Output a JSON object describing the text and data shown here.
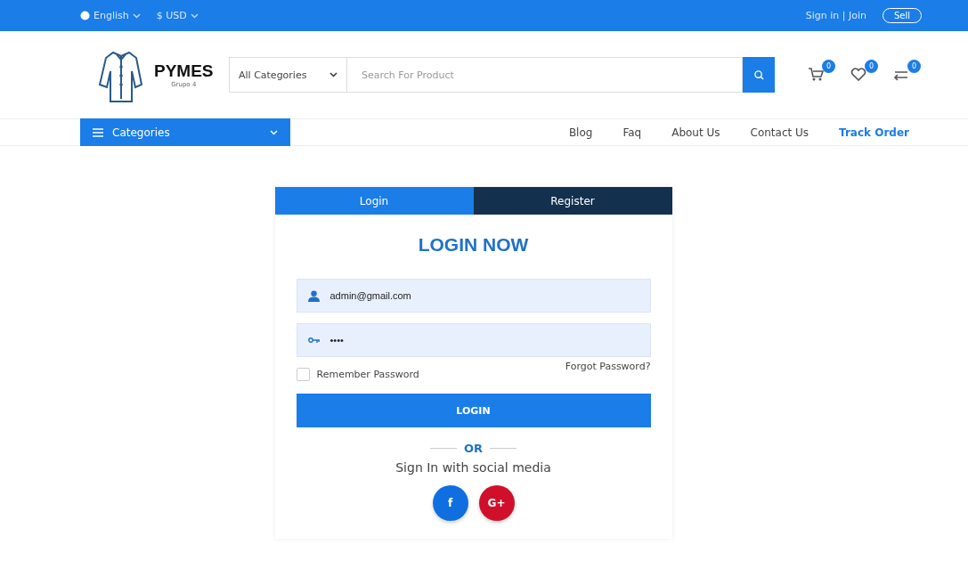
{
  "top_bar": {
    "language": "English",
    "currency": "$ USD",
    "sign_in": "Sign in | Join",
    "sell": "Sell"
  },
  "header": {
    "logo_title": "PYMES",
    "logo_subtitle": "Grupo 4",
    "category_select": "All Categories",
    "search": {
      "placeholder": "Search For Product"
    },
    "badges": [
      {
        "kind": "cart",
        "count": "0"
      },
      {
        "kind": "heart",
        "count": "0"
      },
      {
        "kind": "compare",
        "count": "0"
      }
    ]
  },
  "nav": {
    "categories": "Categories",
    "links": [
      {
        "label": "Blog",
        "selected": false
      },
      {
        "label": "Faq",
        "selected": false
      },
      {
        "label": "About Us",
        "selected": false
      },
      {
        "label": "Contact Us",
        "selected": false
      },
      {
        "label": "Track Order",
        "selected": true
      }
    ]
  },
  "login": {
    "tabs": [
      {
        "label": "Login",
        "selected": true
      },
      {
        "label": "Register",
        "selected": false
      }
    ],
    "title": "LOGIN NOW",
    "email": "admin@gmail.com",
    "password": "••••",
    "remember": {
      "label": "Remember Password",
      "checked": false
    },
    "forgot": "Forgot Password?",
    "button": "LOGIN",
    "or": "OR",
    "social_text": "Sign In with social media",
    "social": [
      {
        "label": "f",
        "color": "#0f6fe0"
      },
      {
        "label": "G+",
        "color": "#d0102b"
      }
    ]
  }
}
